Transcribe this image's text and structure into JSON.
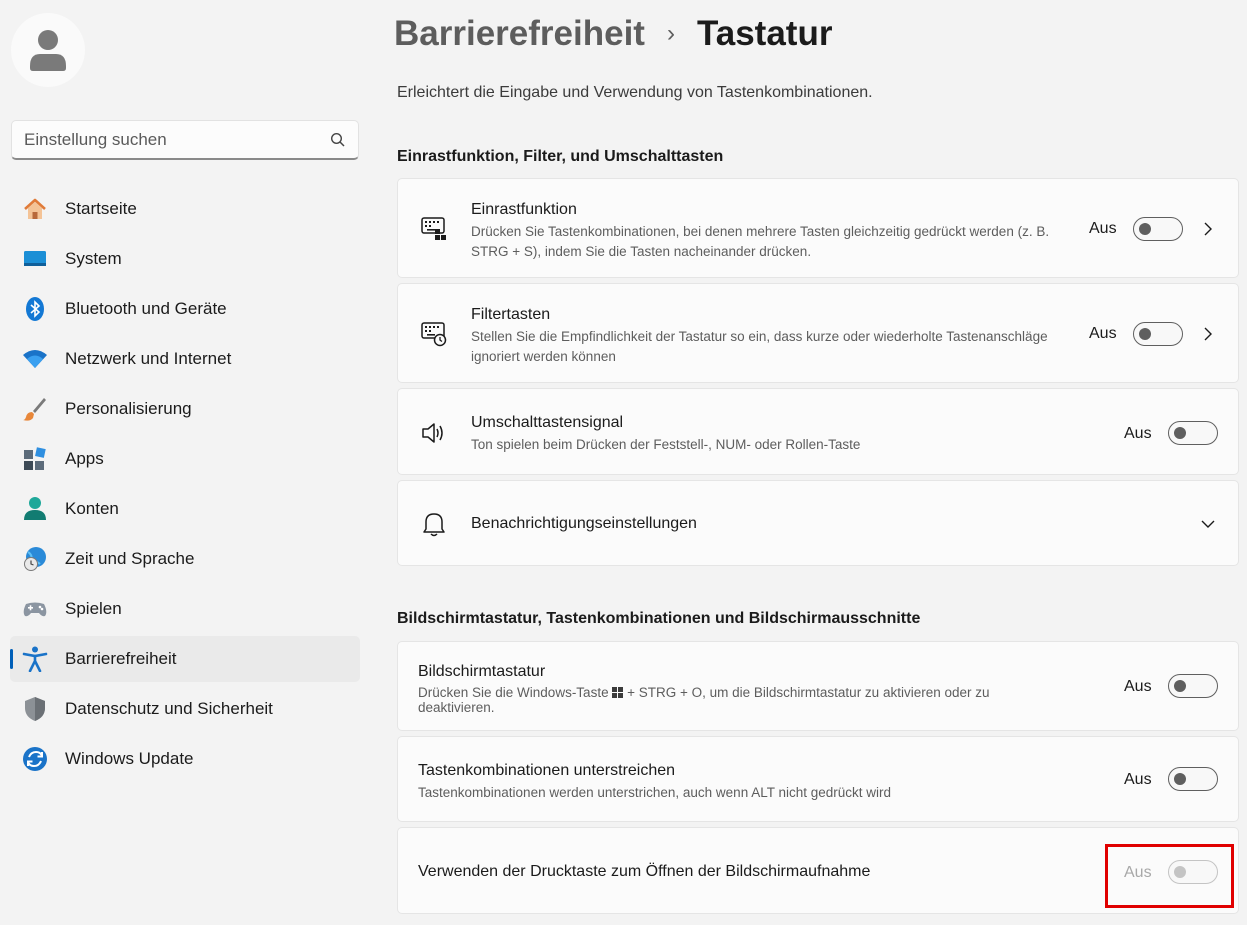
{
  "search": {
    "placeholder": "Einstellung suchen"
  },
  "sidebar": {
    "items": [
      {
        "label": "Startseite",
        "icon": "home-icon"
      },
      {
        "label": "System",
        "icon": "monitor-icon"
      },
      {
        "label": "Bluetooth und Geräte",
        "icon": "bluetooth-icon"
      },
      {
        "label": "Netzwerk und Internet",
        "icon": "wifi-icon"
      },
      {
        "label": "Personalisierung",
        "icon": "brush-icon"
      },
      {
        "label": "Apps",
        "icon": "apps-icon"
      },
      {
        "label": "Konten",
        "icon": "person-icon"
      },
      {
        "label": "Zeit und Sprache",
        "icon": "globe-clock-icon"
      },
      {
        "label": "Spielen",
        "icon": "gamepad-icon"
      },
      {
        "label": "Barrierefreiheit",
        "icon": "accessibility-icon",
        "active": true
      },
      {
        "label": "Datenschutz und Sicherheit",
        "icon": "shield-icon"
      },
      {
        "label": "Windows Update",
        "icon": "update-icon"
      }
    ]
  },
  "header": {
    "breadcrumb_parent": "Barrierefreiheit",
    "breadcrumb_separator": "›",
    "title": "Tastatur",
    "subtitle": "Erleichtert die Eingabe und Verwendung von Tastenkombinationen."
  },
  "sections": {
    "filter_title": "Einrastfunktion, Filter, und Umschalttasten",
    "onscreen_title": "Bildschirmtastatur, Tastenkombinationen und Bildschirmausschnitte"
  },
  "settings": {
    "sticky": {
      "title": "Einrastfunktion",
      "desc": "Drücken Sie Tastenkombinationen, bei denen mehrere Tasten gleichzeitig gedrückt werden (z. B. STRG + S), indem Sie die Tasten nacheinander drücken.",
      "state": "Aus",
      "on": false,
      "icon": "keyboard-sticky-icon"
    },
    "filter": {
      "title": "Filtertasten",
      "desc": "Stellen Sie die Empfindlichkeit der Tastatur so ein, dass kurze oder wiederholte Tastenanschläge ignoriert werden können",
      "state": "Aus",
      "on": false,
      "icon": "keyboard-filter-icon"
    },
    "toggle_keys": {
      "title": "Umschalttastensignal",
      "desc": "Ton spielen beim Drücken der Feststell-, NUM- oder Rollen-Taste",
      "state": "Aus",
      "on": false,
      "icon": "speaker-icon"
    },
    "notifications": {
      "title": "Benachrichtigungseinstellungen",
      "icon": "bell-icon"
    },
    "onscreen_keyboard": {
      "title": "Bildschirmtastatur",
      "desc_before": "Drücken Sie die Windows-Taste",
      "desc_after": "+ STRG + O, um die Bildschirmtastatur zu aktivieren oder zu deaktivieren.",
      "state": "Aus",
      "on": false
    },
    "underline_access": {
      "title": "Tastenkombinationen unterstreichen",
      "desc": "Tastenkombinationen werden unterstrichen, auch wenn ALT nicht gedrückt wird",
      "state": "Aus",
      "on": false
    },
    "print_screen": {
      "title": "Verwenden der Drucktaste zum Öffnen der Bildschirmaufnahme",
      "state": "Aus",
      "on": false,
      "disabled": true
    }
  },
  "colors": {
    "accent": "#005fb8",
    "highlight_border": "#e00000"
  }
}
